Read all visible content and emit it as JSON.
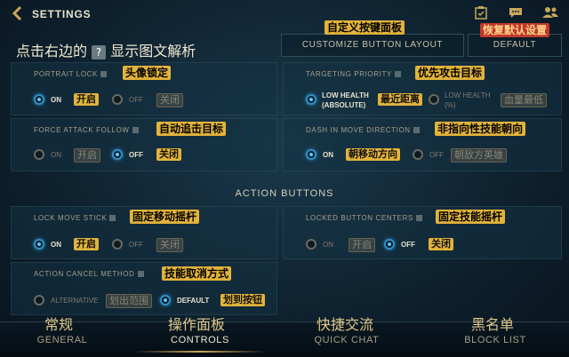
{
  "header": {
    "back_icon": "chevron-left-icon",
    "title": "SETTINGS",
    "icons": [
      "clipboard-icon",
      "chat-icon",
      "friends-icon"
    ]
  },
  "hint": {
    "text": "点击右边的",
    "glyph": "?",
    "text2": "显示图文解析"
  },
  "top_buttons": {
    "customize_label": "CUSTOMIZE BUTTON LAYOUT",
    "customize_tag": "自定义按键面板",
    "default_label": "DEFAULT",
    "default_tag": "恢复默认设置"
  },
  "section_title": "ACTION BUTTONS",
  "settings": {
    "portrait_lock": {
      "label": "PORTRAIT LOCK",
      "tag": "头像锁定",
      "on": "ON",
      "on_tag": "开启",
      "off": "OFF",
      "off_tag": "关闭"
    },
    "targeting_priority": {
      "label": "TARGETING PRIORITY",
      "tag": "优先攻击目标",
      "opt1_line1": "LOW HEALTH",
      "opt1_line2": "(ABSOLUTE)",
      "opt1_tag": "最近距离",
      "opt2_line1": "LOW HEALTH",
      "opt2_line2": "(%)",
      "opt2_tag": "血量最低"
    },
    "force_attack_follow": {
      "label": "FORCE ATTACK FOLLOW",
      "tag": "自动追击目标",
      "on": "ON",
      "on_tag": "开启",
      "off": "OFF",
      "off_tag": "关闭"
    },
    "dash_in_move_direction": {
      "label": "DASH IN MOVE DIRECTION",
      "tag": "非指向性技能朝向",
      "on": "ON",
      "on_tag": "朝移动方向",
      "off": "OFF",
      "off_tag": "朝敌方英雄"
    },
    "lock_move_stick": {
      "label": "LOCK MOVE STICK",
      "tag": "固定移动摇杆",
      "on": "ON",
      "on_tag": "开启",
      "off": "OFF",
      "off_tag": "关闭"
    },
    "locked_button_centers": {
      "label": "LOCKED BUTTON CENTERS",
      "tag": "固定技能摇杆",
      "on": "ON",
      "on_tag": "开启",
      "off": "OFF",
      "off_tag": "关闭"
    },
    "action_cancel_method": {
      "label": "ACTION CANCEL METHOD",
      "tag": "技能取消方式",
      "opt1": "ALTERNATIVE",
      "opt1_tag": "划出范围",
      "opt2": "DEFAULT",
      "opt2_tag": "划到按钮"
    }
  },
  "nav": [
    {
      "label": "GENERAL",
      "cn": "常规"
    },
    {
      "label": "CONTROLS",
      "cn": "操作面板"
    },
    {
      "label": "QUICK CHAT",
      "cn": "快捷交流"
    },
    {
      "label": "BLOCK LIST",
      "cn": "黑名单"
    }
  ],
  "colors": {
    "accent_gold": "#c9a75a",
    "tag_yellow": "#e2b33a",
    "radio_on": "#2f8fc8"
  }
}
